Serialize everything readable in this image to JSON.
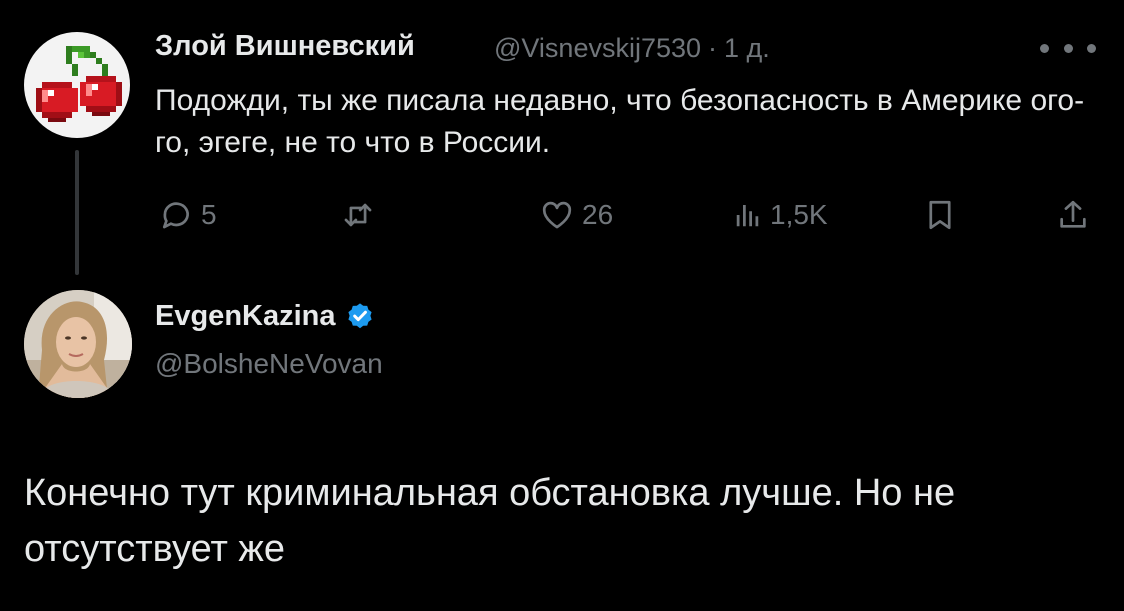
{
  "parent_tweet": {
    "author_name": "Злой Вишневский",
    "handle": "@Visnevskij7530",
    "separator": "·",
    "time": "1 д.",
    "text": "Подожди, ты же писала недавно, что безопасность в Америке ого-го, эгеге, не то что в России.",
    "avatar_icon": "cherry-icon",
    "actions": {
      "replies": "5",
      "reposts": "",
      "likes": "26",
      "views": "1,5K"
    }
  },
  "reply_tweet": {
    "author_name": "EvgenKazina",
    "handle": "@BolsheNeVovan",
    "verified": true,
    "text": "Конечно тут криминальная обстановка лучше. Но не отсутствует же"
  },
  "colors": {
    "background": "#000000",
    "primary_text": "#e7e9ea",
    "secondary_text": "#71767b",
    "verified_badge": "#1d9bf0",
    "thread_line": "#333639"
  }
}
